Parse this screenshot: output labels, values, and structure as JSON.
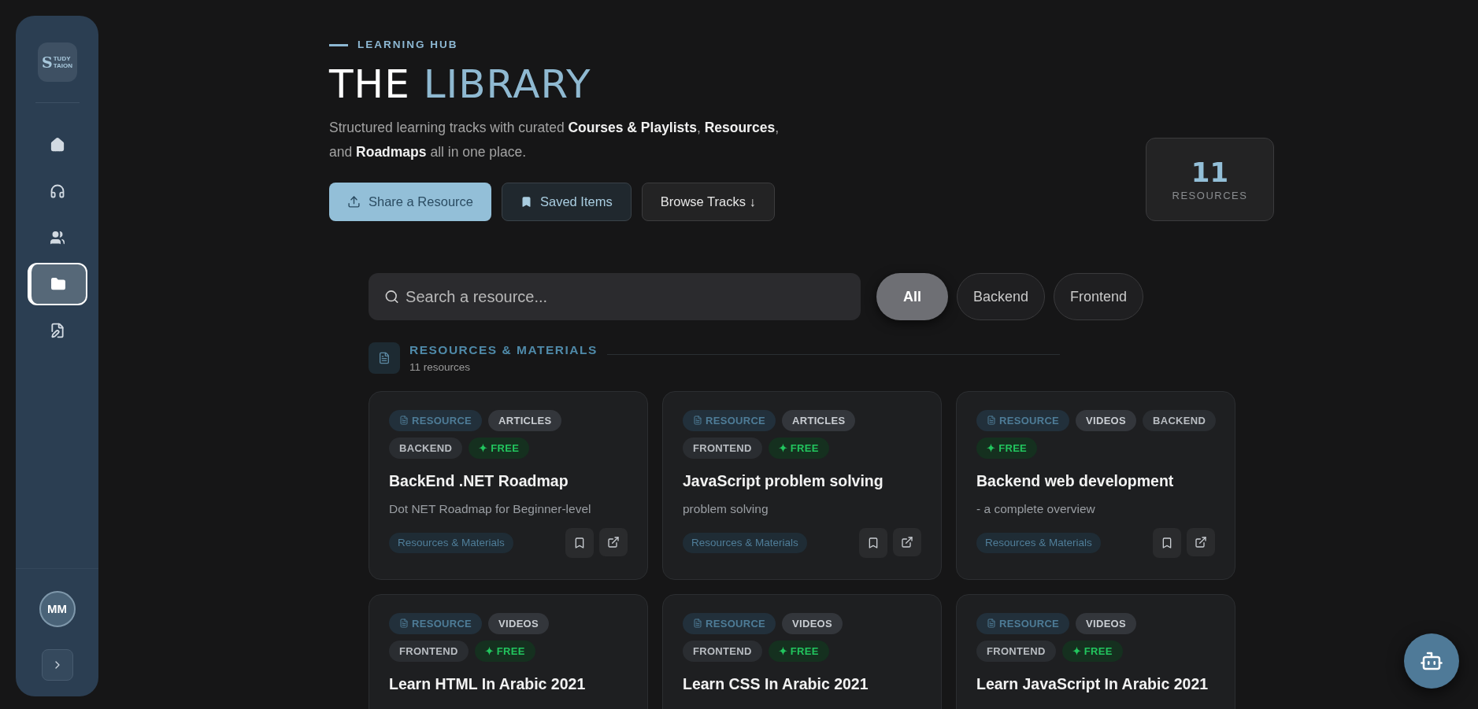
{
  "sidebar": {
    "logo": {
      "initial": "S",
      "lines": [
        "TUDY",
        "TAION"
      ]
    },
    "nav": [
      {
        "kind": "home",
        "selected": false
      },
      {
        "kind": "headphones",
        "selected": false
      },
      {
        "kind": "users",
        "selected": false
      },
      {
        "kind": "folder",
        "selected": true
      },
      {
        "kind": "file-edit",
        "selected": false
      }
    ],
    "avatar": "MM"
  },
  "header": {
    "eyebrow": "LEARNING HUB",
    "title": "THE",
    "title_accent": "LIBRARY",
    "description": "Structured learning tracks with curated **Courses & Playlists**, **Resources**, and **Roadmaps** all in one place.",
    "buttons": [
      {
        "kind": "primary",
        "label": "Share a Resource"
      },
      {
        "kind": "saved",
        "label": "Saved Items"
      },
      {
        "kind": "plain",
        "label": "Browse Tracks ↓"
      }
    ],
    "stat": {
      "value": "11",
      "label": "RESOURCES"
    }
  },
  "search": {
    "placeholder": "Search a resource..."
  },
  "filters": [
    {
      "label": "All",
      "selected": true
    },
    {
      "label": "Backend",
      "selected": false
    },
    {
      "label": "Frontend",
      "selected": false
    }
  ],
  "section": {
    "title": "RESOURCES & MATERIALS",
    "count": "11 resources"
  },
  "cards": [
    {
      "tags": [
        {
          "kind": "resource",
          "label": "RESOURCE"
        },
        {
          "kind": "type",
          "label": "ARTICLES"
        },
        {
          "kind": "category",
          "label": "BACKEND"
        },
        {
          "kind": "free",
          "label": "✦ FREE"
        }
      ],
      "title": "BackEnd .NET Roadmap",
      "description": "Dot NET Roadmap for Beginner-level",
      "footer_tag": "Resources & Materials"
    },
    {
      "tags": [
        {
          "kind": "resource",
          "label": "RESOURCE"
        },
        {
          "kind": "type",
          "label": "ARTICLES"
        },
        {
          "kind": "category",
          "label": "FRONTEND"
        },
        {
          "kind": "free",
          "label": "✦ FREE"
        }
      ],
      "title": "JavaScript problem solving",
      "description": "problem solving",
      "footer_tag": "Resources & Materials"
    },
    {
      "tags": [
        {
          "kind": "resource",
          "label": "RESOURCE"
        },
        {
          "kind": "type",
          "label": "VIDEOS"
        },
        {
          "kind": "category",
          "label": "BACKEND"
        },
        {
          "kind": "free",
          "label": "✦ FREE"
        }
      ],
      "title": "Backend web development",
      "description": "- a complete overview",
      "footer_tag": "Resources & Materials"
    },
    {
      "tags": [
        {
          "kind": "resource",
          "label": "RESOURCE"
        },
        {
          "kind": "type",
          "label": "VIDEOS"
        },
        {
          "kind": "category",
          "label": "FRONTEND"
        },
        {
          "kind": "free",
          "label": "✦ FREE"
        }
      ],
      "title": "Learn HTML In Arabic 2021"
    },
    {
      "tags": [
        {
          "kind": "resource",
          "label": "RESOURCE"
        },
        {
          "kind": "type",
          "label": "VIDEOS"
        },
        {
          "kind": "category",
          "label": "FRONTEND"
        },
        {
          "kind": "free",
          "label": "✦ FREE"
        }
      ],
      "title": "Learn CSS In Arabic 2021"
    },
    {
      "tags": [
        {
          "kind": "resource",
          "label": "RESOURCE"
        },
        {
          "kind": "type",
          "label": "VIDEOS"
        },
        {
          "kind": "category",
          "label": "FRONTEND"
        },
        {
          "kind": "free",
          "label": "✦ FREE"
        }
      ],
      "title": "Learn JavaScript In Arabic 2021"
    }
  ]
}
